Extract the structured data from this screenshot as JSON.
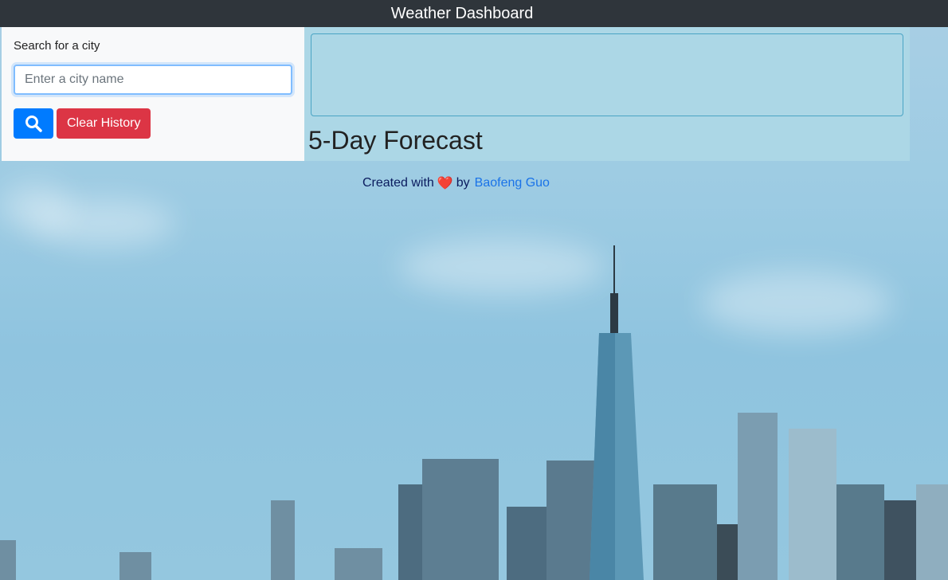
{
  "header": {
    "title": "Weather Dashboard"
  },
  "search": {
    "label": "Search for a city",
    "placeholder": "Enter a city name",
    "search_icon": "search-icon",
    "clear_label": "Clear History"
  },
  "main": {
    "forecast_heading": "5-Day Forecast"
  },
  "footer": {
    "created_with": "Created with",
    "heart": "❤️",
    "by": "by",
    "author": "Baofeng Guo"
  },
  "colors": {
    "topbar": "#2f353b",
    "search_button": "#007bff",
    "clear_button": "#dc3545",
    "main_panel": "#add8e6"
  }
}
